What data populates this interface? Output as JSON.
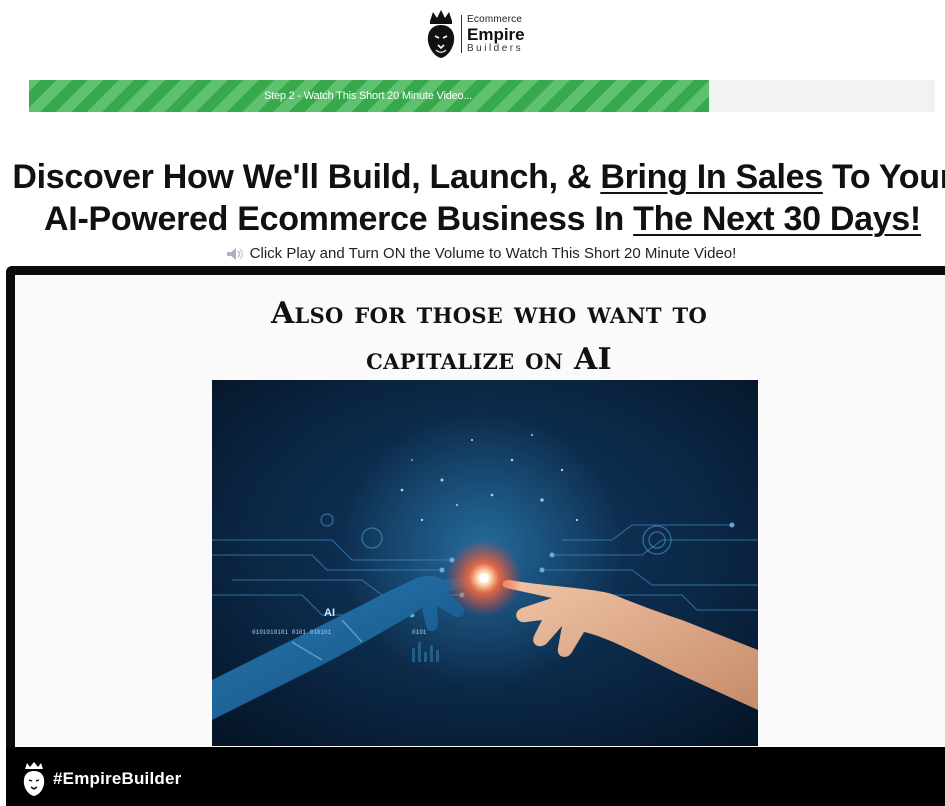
{
  "logo": {
    "line1": "Ecommerce",
    "line2": "Empire",
    "line3": "Builders",
    "icon": "crowned-lion-icon"
  },
  "progress": {
    "label": "Step 2 - Watch This Short 20 Minute Video...",
    "fraction": 0.75,
    "fill_color": "#38a84d",
    "stripe_color": "#5fc06f"
  },
  "headline": {
    "line1_pre": "Discover How We'll Build, Launch, & ",
    "line1_underlined": "Bring In Sales",
    "line1_post": " To Your",
    "line2_pre": "AI-Powered Ecommerce Business In ",
    "line2_underlined": "The Next 30 Days!"
  },
  "subline": {
    "icon": "speaker-volume-icon",
    "text": "Click Play and Turn ON the Volume to Watch This Short 20 Minute Video!"
  },
  "video": {
    "slide_title_line1": "Also for those who want to",
    "slide_title_line2": "capitalize on AI",
    "image_label": "AI",
    "image_bits_1": "0101010101 0101 010101",
    "image_bits_2": "0101",
    "brand_icon": "crowned-lion-icon",
    "brand_text": "#EmpireBuilder"
  }
}
